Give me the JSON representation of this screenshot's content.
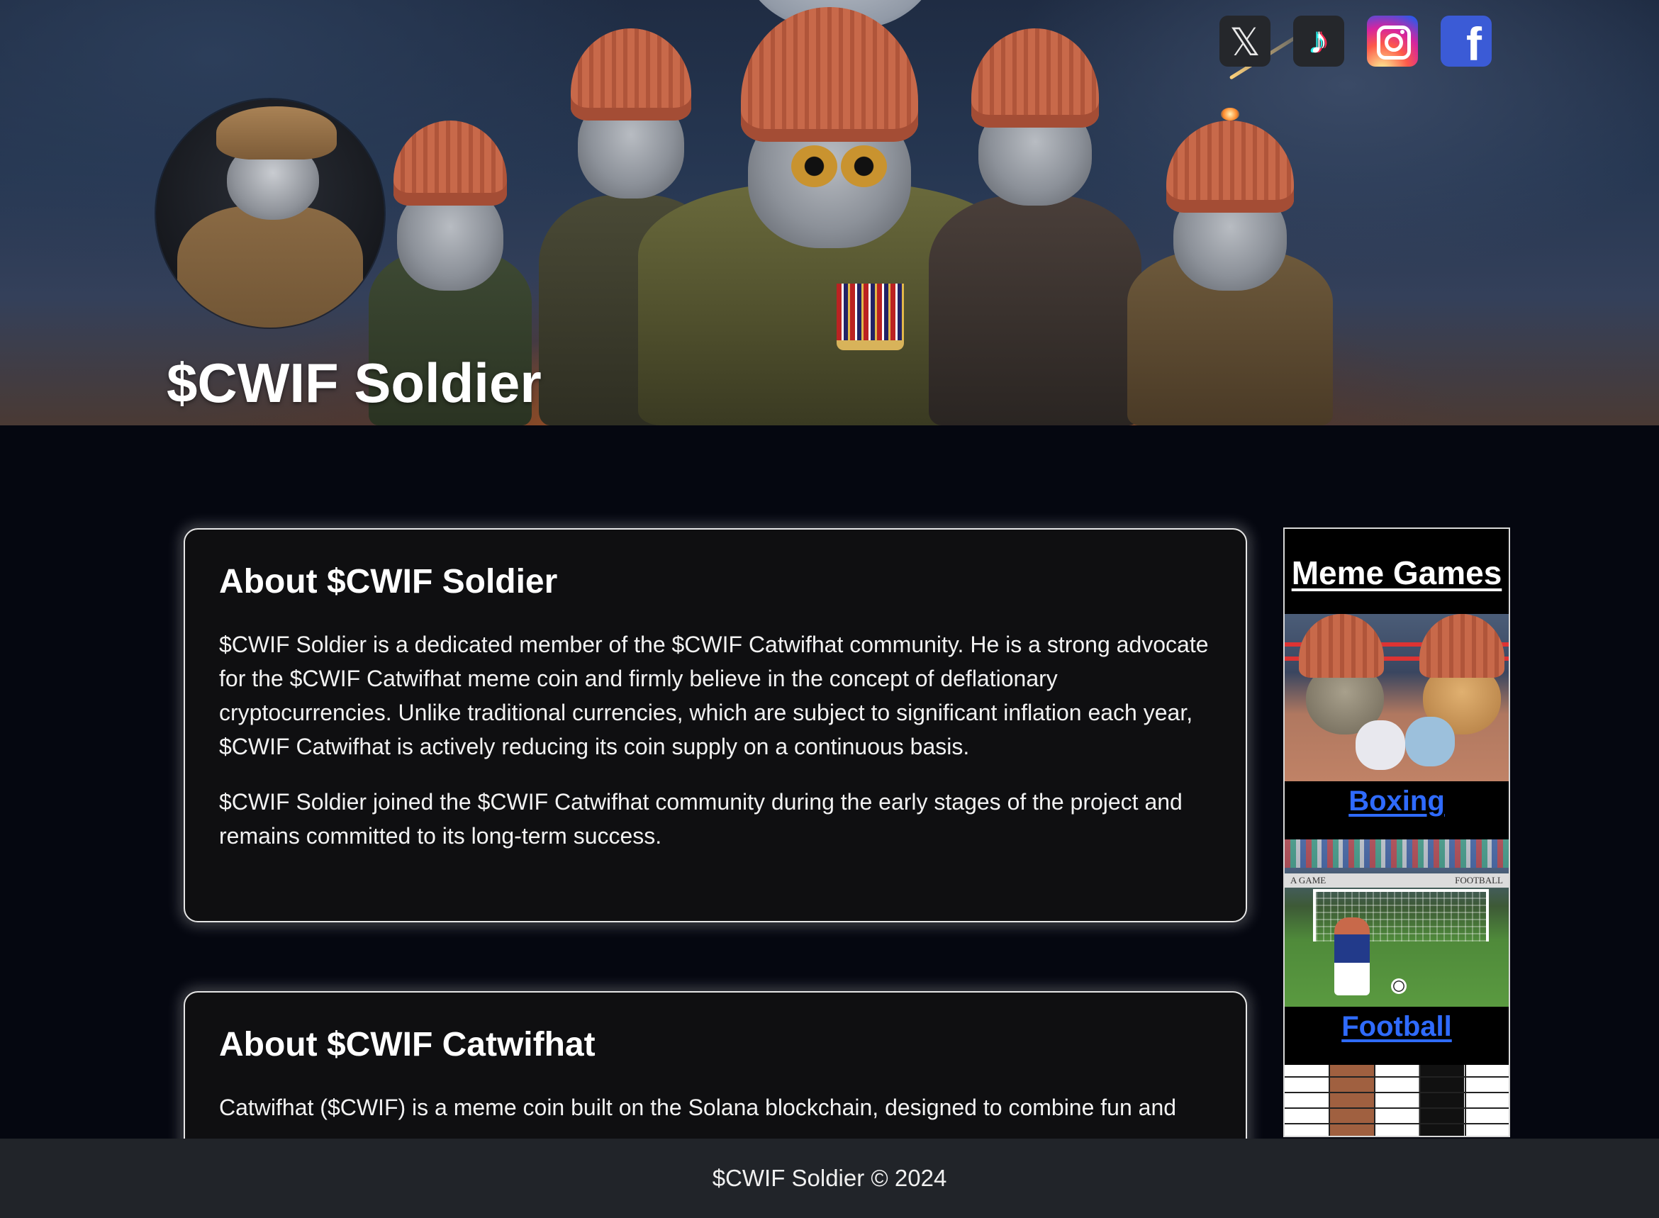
{
  "hero": {
    "title": "$CWIF Soldier"
  },
  "social": [
    {
      "name": "x-icon",
      "glyph": "𝕏"
    },
    {
      "name": "tiktok-icon",
      "glyph": "♪"
    },
    {
      "name": "instagram-icon",
      "glyph": ""
    },
    {
      "name": "facebook-icon",
      "glyph": "f"
    }
  ],
  "about_soldier": {
    "heading": "About $CWIF Soldier",
    "paragraphs": [
      "$CWIF Soldier is a dedicated member of the $CWIF Catwifhat community. He is a strong advocate for the $CWIF Catwifhat meme coin and firmly believe in the concept of deflationary cryptocurrencies. Unlike traditional currencies, which are subject to significant inflation each year, $CWIF Catwifhat is actively reducing its coin supply on a continuous basis.",
      "$CWIF Soldier joined the $CWIF Catwifhat community during the early stages of the project and remains committed to its long-term success."
    ]
  },
  "about_catwifhat": {
    "heading": "About $CWIF Catwifhat",
    "paragraphs": [
      "Catwifhat ($CWIF) is a meme coin built on the Solana blockchain, designed to combine fun and"
    ]
  },
  "sidebar": {
    "heading": "Meme Games",
    "games": [
      {
        "label": "Boxing"
      },
      {
        "label": "Football"
      }
    ],
    "football_banner_left": "A GAME",
    "football_banner_right": "FOOTBALL"
  },
  "footer": {
    "text": "$CWIF Soldier © 2024"
  },
  "colors": {
    "page_bg": "#050710",
    "card_bg": "#0f0f11",
    "footer_bg": "#212429",
    "link": "#2f6bff"
  }
}
